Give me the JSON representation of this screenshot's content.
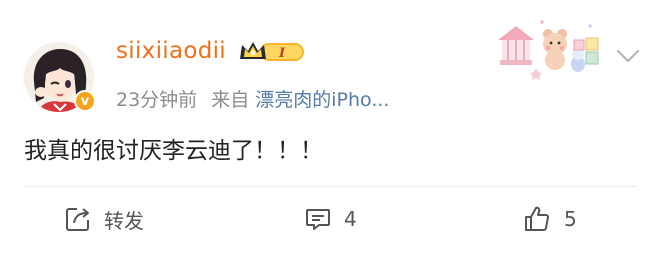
{
  "post": {
    "user": {
      "name": "siixiiaodii",
      "vip_level": "I",
      "verified_mark": "v"
    },
    "meta": {
      "time": "23分钟前",
      "from_label": "来自",
      "source": "漂亮肉的iPho..."
    },
    "text": "我真的很讨厌李云迪了！！！",
    "actions": {
      "repost_label": "转发",
      "comment_count": "4",
      "like_count": "5"
    },
    "colors": {
      "username": "#f06f18",
      "source_link": "#557aa8",
      "meta_gray": "#8d8d8d",
      "vip_gold": "#f7b52b"
    },
    "icons": [
      "crown-vip-icon",
      "carousel-decoration-icon",
      "chevron-down-icon",
      "repost-icon",
      "comment-icon",
      "like-icon"
    ]
  }
}
